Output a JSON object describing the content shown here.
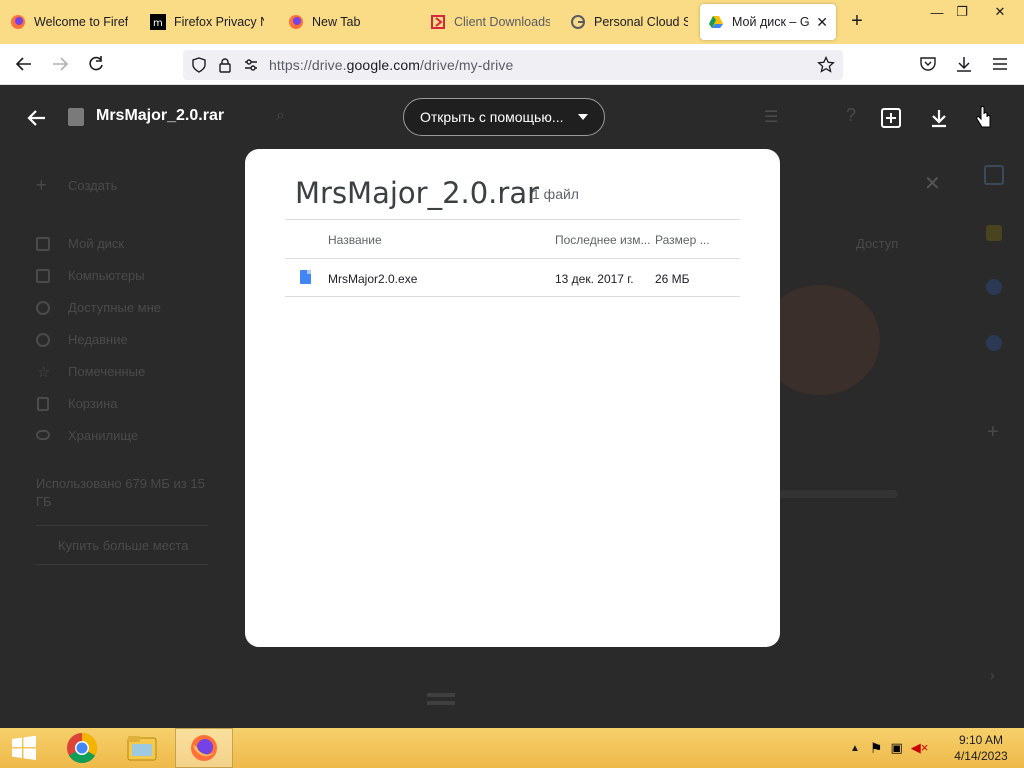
{
  "browser": {
    "tabs": [
      {
        "label": "Welcome to Firefox",
        "icon": "firefox-icon"
      },
      {
        "label": "Firefox Privacy Notice",
        "icon": "mozilla-icon"
      },
      {
        "label": "New Tab",
        "icon": "firefox-icon"
      },
      {
        "label": "Client Downloads",
        "icon": "client-logo-icon"
      },
      {
        "label": "Personal Cloud Storage",
        "icon": "google-icon"
      },
      {
        "label": "Мой диск – Google Drive",
        "icon": "google-drive-icon"
      }
    ],
    "url_prefix": "https://drive.",
    "url_domain": "google.com",
    "url_path": "/drive/my-drive"
  },
  "drive_background": {
    "create_label": "Создать",
    "nav": [
      "Мой диск",
      "Компьютеры",
      "Доступные мне",
      "Недавние",
      "Помеченные",
      "Корзина",
      "Хранилище"
    ],
    "storage_text": "Использовано 679 МБ из 15 ГБ",
    "buy_storage": "Купить больше места",
    "col_label": "Доступ"
  },
  "preview": {
    "file_title": "MrsMajor_2.0.rar",
    "open_with_label": "Открыть с помощью..."
  },
  "modal": {
    "title": "MrsMajor_2.0.rar",
    "count": "1 файл",
    "columns": [
      "Название",
      "Последнее изм...",
      "Размер ..."
    ],
    "rows": [
      {
        "name": "MrsMajor2.0.exe",
        "modified": "13 дек. 2017 г.",
        "size": "26 МБ"
      }
    ]
  },
  "taskbar": {
    "time": "9:10 AM",
    "date": "4/14/2023"
  },
  "colors": {
    "tabstrip": "#f9dc85",
    "taskbar": "#f3c95a",
    "overlay": "#2a2a2a",
    "file_icon": "#4285f4"
  }
}
